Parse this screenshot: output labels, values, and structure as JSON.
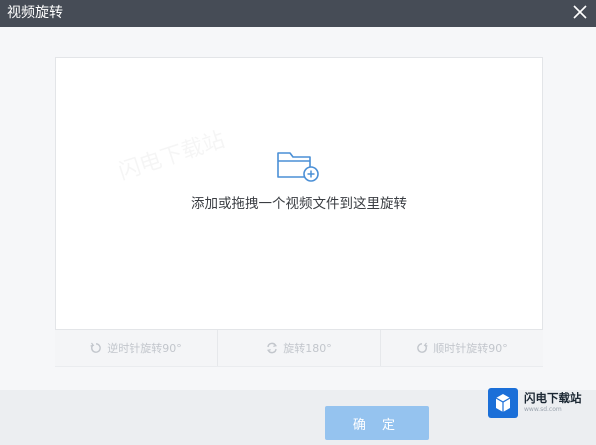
{
  "window": {
    "title": "视频旋转"
  },
  "dropzone": {
    "hint": "添加或拖拽一个视频文件到这里旋转",
    "icon": "folder-add-icon",
    "watermark": "闪电下载站"
  },
  "toolbar": {
    "items": [
      {
        "label": "逆时针旋转90°",
        "icon": "rotate-ccw-icon"
      },
      {
        "label": "旋转180°",
        "icon": "rotate-180-icon"
      },
      {
        "label": "顺时针旋转90°",
        "icon": "rotate-cw-icon"
      }
    ]
  },
  "footer": {
    "ok_label": "确 定"
  },
  "logo": {
    "name": "闪电下载站",
    "url": "www.sd.com"
  },
  "colors": {
    "titlebar": "#464c56",
    "accent": "#4a8fd6",
    "ok_button": "#95c3ef"
  }
}
